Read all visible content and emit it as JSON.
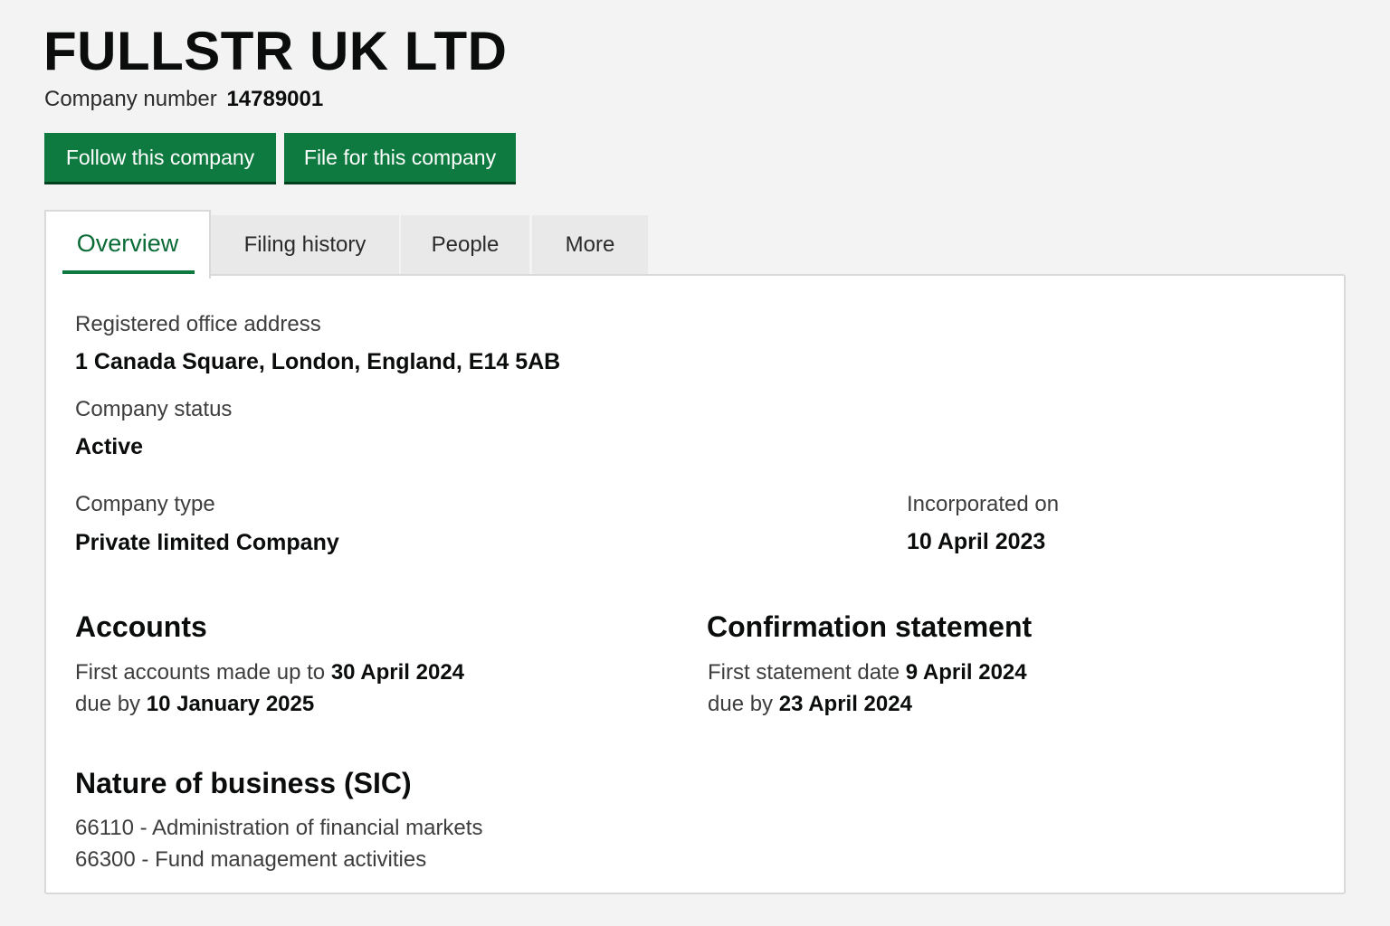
{
  "header": {
    "company_name": "FULLSTR UK LTD",
    "company_number_label": "Company number",
    "company_number": "14789001"
  },
  "actions": {
    "follow_label": "Follow this company",
    "file_label": "File for this company"
  },
  "tabs": [
    {
      "label": "Overview",
      "active": true
    },
    {
      "label": "Filing history",
      "active": false
    },
    {
      "label": "People",
      "active": false
    },
    {
      "label": "More",
      "active": false
    }
  ],
  "overview": {
    "registered_office_label": "Registered office address",
    "registered_office_value": "1 Canada Square, London, England, E14 5AB",
    "status_label": "Company status",
    "status_value": "Active",
    "type_label": "Company type",
    "type_value": "Private limited Company",
    "incorporated_label": "Incorporated on",
    "incorporated_value": "10 April 2023"
  },
  "accounts": {
    "heading": "Accounts",
    "first_made_up_label": "First accounts made up to",
    "first_made_up_date": "30 April 2024",
    "due_label": "due by",
    "due_date": "10 January 2025"
  },
  "confirmation": {
    "heading": "Confirmation statement",
    "first_statement_label": "First statement date",
    "first_statement_date": "9 April 2024",
    "due_label": "due by",
    "due_date": "23 April 2024"
  },
  "sic": {
    "heading": "Nature of business (SIC)",
    "items": [
      "66110 - Administration of financial markets",
      "66300 - Fund management activities"
    ]
  },
  "colors": {
    "primary_green": "#0f7a3f",
    "tab_active_text": "#0b6b36",
    "page_background": "#f3f3f3"
  }
}
